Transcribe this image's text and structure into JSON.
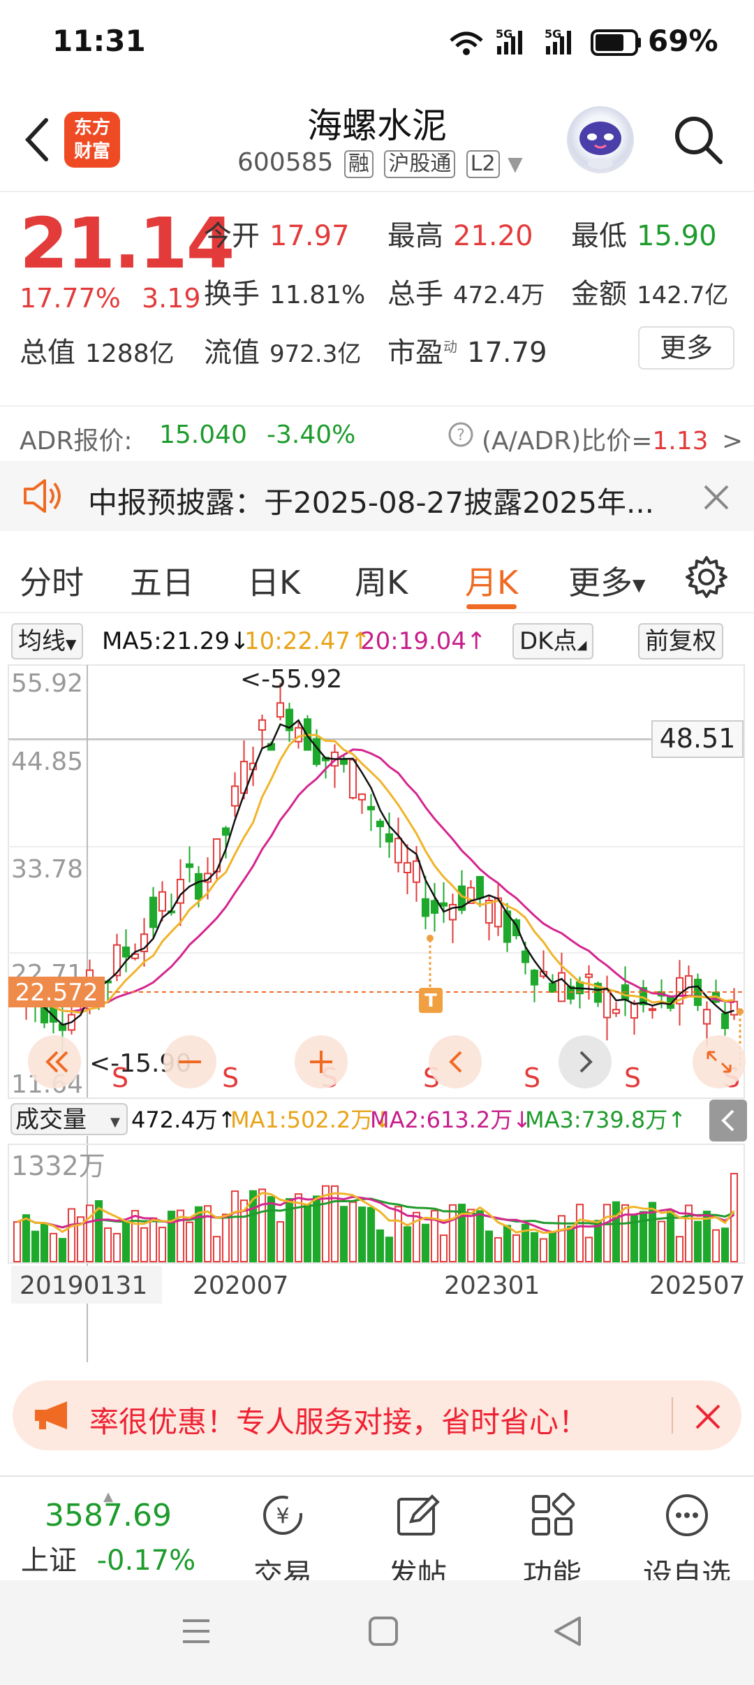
{
  "status_bar": {
    "time": "11:31",
    "battery": "69%",
    "signal1": "5G",
    "signal2": "5G"
  },
  "header": {
    "logo_text": [
      "东方",
      "财富"
    ],
    "stock_name": "海螺水泥",
    "stock_code": "600585",
    "tags": [
      "融",
      "沪股通",
      "L2"
    ]
  },
  "quote": {
    "price": "21.14",
    "change_pct": "17.77%",
    "change": "3.19",
    "open_label": "今开",
    "open": "17.97",
    "high_label": "最高",
    "high": "21.20",
    "low_label": "最低",
    "low": "15.90",
    "turnover_label": "换手",
    "turnover": "11.81%",
    "volume_label": "总手",
    "volume": "472.4万",
    "amount_label": "金额",
    "amount": "142.7亿",
    "mktcap_label": "总值",
    "mktcap": "1288亿",
    "float_label": "流值",
    "float": "972.3亿",
    "pe_label": "市盈",
    "pe_sup": "动",
    "pe": "17.79",
    "more": "更多"
  },
  "adr": {
    "label": "ADR报价:",
    "price": "15.040",
    "change": "-3.40%",
    "ratio_label": "(A/ADR)比价=",
    "ratio": "1.13",
    "arrow": ">"
  },
  "notice": {
    "text": "中报预披露：于2025-08-27披露2025年..."
  },
  "tabs": [
    "分时",
    "五日",
    "日K",
    "周K",
    "月K",
    "更多"
  ],
  "active_tab": "月K",
  "ma_bar": {
    "indicator": "均线",
    "ma5": "MA5:21.29",
    "ma10": "10:22.47",
    "ma20": "20:19.04",
    "dk": "DK点",
    "adjust": "前复权"
  },
  "chart_data": {
    "type": "candlestick",
    "y_ticks": [
      "55.92",
      "44.85",
      "33.78",
      "22.71",
      "11.64"
    ],
    "ylim": [
      11.64,
      55.92
    ],
    "x_ticks": [
      "20190131",
      "202007",
      "202301",
      "202507"
    ],
    "max_label": "55.92",
    "min_label": "15.90",
    "crosshair_price": "48.51",
    "current_price_label": "22.572",
    "markers": [
      "S",
      "S",
      "S",
      "S",
      "S",
      "S",
      "S"
    ],
    "t_marker": "T",
    "volume_indicator": "成交量",
    "volume_value": "472.4万",
    "vol_ma1": "MA1:502.2万",
    "vol_ma2": "MA2:613.2万",
    "vol_ma3": "MA3:739.8万",
    "volume_max": "1332万",
    "colors": {
      "up": "#e33a3a",
      "down": "#1ea82c",
      "ma5": "#111111",
      "ma10": "#f0b429",
      "ma20": "#d4258f",
      "vol_ma3": "#1e9b2c"
    }
  },
  "promo": {
    "text": "率很优惠！专人服务对接，省时省心！"
  },
  "bottom_bar": {
    "index_value": "3587.69",
    "index_name": "上证",
    "index_change": "-0.17%",
    "items": [
      "交易",
      "发帖",
      "功能",
      "设自选"
    ]
  }
}
